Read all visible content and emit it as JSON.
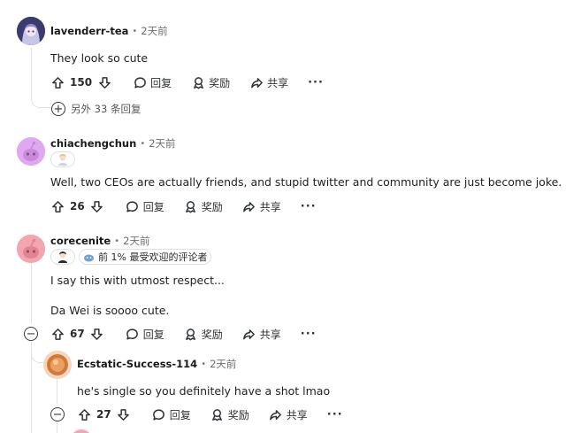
{
  "comments": [
    {
      "username": "lavenderr-tea",
      "time": "2天前",
      "text": "They look so cute",
      "score": "150",
      "reply_label": "回复",
      "award_label": "奖励",
      "share_label": "共享",
      "more_label": "···",
      "more_replies": "另外 33 条回复"
    },
    {
      "username": "chiachengchun",
      "time": "2天前",
      "text": "Well, two CEOs are actually friends, and stupid twitter and community are just become joke.",
      "score": "26",
      "reply_label": "回复",
      "award_label": "奖励",
      "share_label": "共享",
      "more_label": "···"
    },
    {
      "username": "corecenite",
      "time": "2天前",
      "badge_text": "前 1% 最受欢迎的评论者",
      "text_line1": "I say this with utmost respect...",
      "text_line2": "Da Wei is soooo cute.",
      "score": "67",
      "reply_label": "回复",
      "award_label": "奖励",
      "share_label": "共享",
      "more_label": "···",
      "collapse_label": "−"
    },
    {
      "username": "Ecstatic-Success-114",
      "time": "2天前",
      "text": "he's single so you definitely have a shot lmao",
      "score": "27",
      "reply_label": "回复",
      "award_label": "奖励",
      "share_label": "共享",
      "more_label": "···",
      "collapse_label": "−"
    }
  ],
  "separator": "•",
  "expand_label": "+",
  "colors": {
    "thread_line": "#e0e3e6",
    "avatar_pink": "#f4a6b0",
    "avatar_purple": "#e0a8f0",
    "avatar_lavender": "#3c3a6e",
    "avatar_orange": "#d07a3a"
  }
}
